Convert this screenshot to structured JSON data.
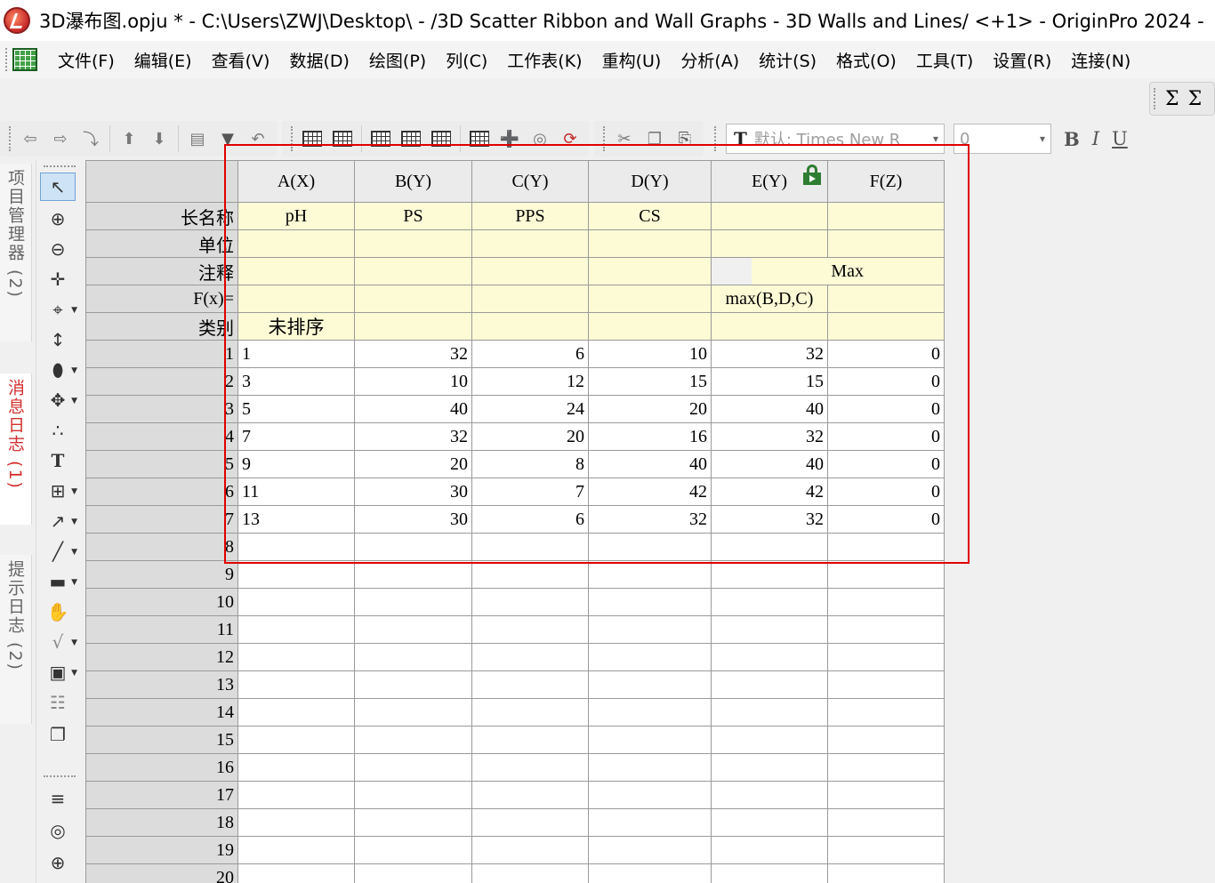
{
  "window": {
    "title": "3D瀑布图.opju * - C:\\Users\\ZWJ\\Desktop\\ - /3D Scatter Ribbon and Wall Graphs - 3D Walls and Lines/ <+1> - OriginPro 2024 -"
  },
  "menu": {
    "items": [
      "文件(F)",
      "编辑(E)",
      "查看(V)",
      "数据(D)",
      "绘图(P)",
      "列(C)",
      "工作表(K)",
      "重构(U)",
      "分析(A)",
      "统计(S)",
      "格式(O)",
      "工具(T)",
      "设置(R)",
      "连接(N)"
    ]
  },
  "toolbar": {
    "font_value": "默认: Times New R",
    "size_value": "0",
    "bold_label": "B",
    "italic_label": "I",
    "underline_label": "U",
    "right_label": "Σ"
  },
  "side_tabs": {
    "project_explorer": "项目管理器 (2)",
    "messages_log": "消息日志 (1)",
    "hints_log": "提示日志 (2)"
  },
  "sheet": {
    "columns": [
      "A(X)",
      "B(Y)",
      "C(Y)",
      "D(Y)",
      "E(Y)",
      "F(Z)"
    ],
    "label_rows": [
      {
        "name": "长名称",
        "values": [
          "pH",
          "PS",
          "PPS",
          "CS",
          "",
          ""
        ]
      },
      {
        "name": "单位",
        "values": [
          "",
          "",
          "",
          "",
          "",
          ""
        ]
      },
      {
        "name": "注释",
        "values": [
          "",
          "",
          "",
          "",
          "Max",
          ""
        ]
      },
      {
        "name": "F(x)=",
        "values": [
          "",
          "",
          "",
          "",
          "max(B,D,C)",
          ""
        ]
      },
      {
        "name": "类别",
        "values": [
          "未排序",
          "",
          "",
          "",
          "",
          ""
        ]
      }
    ],
    "data_rows": [
      {
        "n": "1",
        "values": [
          "1",
          "32",
          "6",
          "10",
          "32",
          "0"
        ]
      },
      {
        "n": "2",
        "values": [
          "3",
          "10",
          "12",
          "15",
          "15",
          "0"
        ]
      },
      {
        "n": "3",
        "values": [
          "5",
          "40",
          "24",
          "20",
          "40",
          "0"
        ]
      },
      {
        "n": "4",
        "values": [
          "7",
          "32",
          "20",
          "16",
          "32",
          "0"
        ]
      },
      {
        "n": "5",
        "values": [
          "9",
          "20",
          "8",
          "40",
          "40",
          "0"
        ]
      },
      {
        "n": "6",
        "values": [
          "11",
          "30",
          "7",
          "42",
          "42",
          "0"
        ]
      },
      {
        "n": "7",
        "values": [
          "13",
          "30",
          "6",
          "32",
          "32",
          "0"
        ]
      },
      {
        "n": "8",
        "values": [
          "",
          "",
          "",
          "",
          "",
          ""
        ]
      },
      {
        "n": "9",
        "values": [
          "",
          "",
          "",
          "",
          "",
          ""
        ]
      },
      {
        "n": "10",
        "values": [
          "",
          "",
          "",
          "",
          "",
          ""
        ]
      },
      {
        "n": "11",
        "values": [
          "",
          "",
          "",
          "",
          "",
          ""
        ]
      },
      {
        "n": "12",
        "values": [
          "",
          "",
          "",
          "",
          "",
          ""
        ]
      },
      {
        "n": "13",
        "values": [
          "",
          "",
          "",
          "",
          "",
          ""
        ]
      },
      {
        "n": "14",
        "values": [
          "",
          "",
          "",
          "",
          "",
          ""
        ]
      },
      {
        "n": "15",
        "values": [
          "",
          "",
          "",
          "",
          "",
          ""
        ]
      },
      {
        "n": "16",
        "values": [
          "",
          "",
          "",
          "",
          "",
          ""
        ]
      },
      {
        "n": "17",
        "values": [
          "",
          "",
          "",
          "",
          "",
          ""
        ]
      },
      {
        "n": "18",
        "values": [
          "",
          "",
          "",
          "",
          "",
          ""
        ]
      },
      {
        "n": "19",
        "values": [
          "",
          "",
          "",
          "",
          "",
          ""
        ]
      },
      {
        "n": "20",
        "values": [
          "",
          "",
          "",
          "",
          "",
          ""
        ]
      }
    ]
  },
  "colors": {
    "label_row_bg": "#fdfbd6",
    "header_bg": "#dcdcdc",
    "highlight_box": "#e00000",
    "active_tab_text": "#d32f2f"
  }
}
